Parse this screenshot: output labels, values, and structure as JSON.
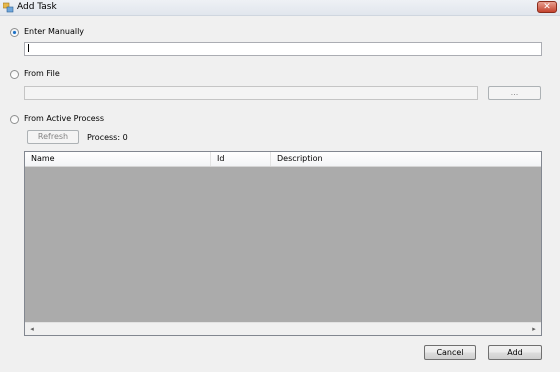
{
  "window": {
    "title": "Add Task",
    "close_glyph": "✕"
  },
  "options": {
    "manual": {
      "label": "Enter Manually",
      "selected": true,
      "value": ""
    },
    "file": {
      "label": "From File",
      "selected": false,
      "path_value": "",
      "browse_label": "..."
    },
    "process": {
      "label": "From Active Process",
      "selected": false,
      "refresh_label": "Refresh",
      "count_text": "Process: 0"
    }
  },
  "process_list": {
    "columns": [
      "Name",
      "Id",
      "Description"
    ],
    "rows": [],
    "scroll_left": "◂",
    "scroll_right": "▸"
  },
  "footer": {
    "cancel_label": "Cancel",
    "add_label": "Add"
  },
  "colors": {
    "list_background": "#ababab",
    "radio_accent": "#1c6fc4",
    "close_button": "#c4432e"
  },
  "icons": {
    "app": "app-icon",
    "close": "close-icon"
  }
}
